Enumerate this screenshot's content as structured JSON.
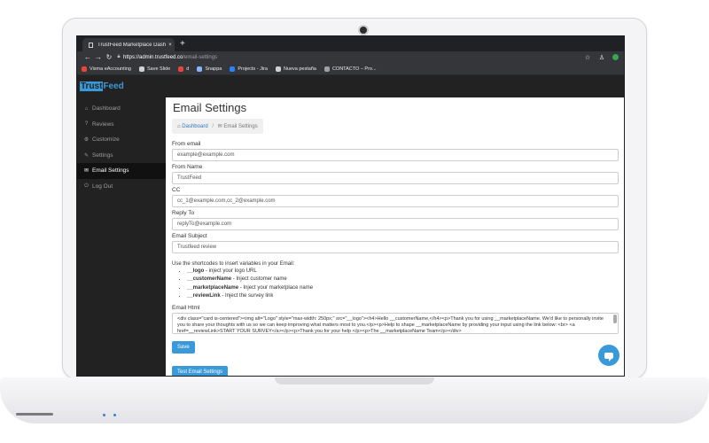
{
  "browser": {
    "tab_title": "TrustFeed Marketplace Dashbo",
    "tab_close": "×",
    "new_tab": "+",
    "url_host": "https://admin.trustfeed.co",
    "url_path": "/email-settings",
    "bookmarks": [
      {
        "label": "Visma eAccounting",
        "color": "#e8453c"
      },
      {
        "label": "Save Slide",
        "color": "#cfd1d4"
      },
      {
        "label": "d",
        "color": "#e8453c"
      },
      {
        "label": "Snappa",
        "color": "#8ab4f8"
      },
      {
        "label": "Projects - Jira",
        "color": "#2684ff"
      },
      {
        "label": "Nueva pestaña",
        "color": "#cfd1d4"
      },
      {
        "label": "CONTACTO – Pro...",
        "color": "#9aa0a6"
      }
    ]
  },
  "logo": {
    "part1": "Trust",
    "part2": "Feed"
  },
  "sidebar": {
    "items": [
      {
        "label": "Dashboard",
        "icon": "⌂"
      },
      {
        "label": "Reviews",
        "icon": "?"
      },
      {
        "label": "Customize",
        "icon": "⚙"
      },
      {
        "label": "Settings",
        "icon": "✎"
      },
      {
        "label": "Email Settings",
        "icon": "✉"
      },
      {
        "label": "Log Out",
        "icon": "⏻"
      }
    ]
  },
  "main": {
    "title": "Email Settings",
    "breadcrumb": {
      "home": "Dashboard",
      "separator": "/",
      "current": "Email Settings"
    },
    "fields": {
      "from_email": {
        "label": "From email",
        "value": "example@example.com"
      },
      "from_name": {
        "label": "From Name",
        "value": "TrustFeed"
      },
      "cc": {
        "label": "CC",
        "value": "cc_1@example.com,cc_2@example.com"
      },
      "reply_to": {
        "label": "Reply To",
        "value": "replyTo@example.com"
      },
      "subject": {
        "label": "Email Subject",
        "value": "Trustfeed review"
      }
    },
    "shortcodes": {
      "intro": "Use the shortcodes to insert variables in your Email:",
      "items": [
        {
          "code": "__logo",
          "desc": " - inject your logo URL"
        },
        {
          "code": "__customerName",
          "desc": " - Inject customer name"
        },
        {
          "code": "__marketplaceName",
          "desc": " - Inject your marketplace name"
        },
        {
          "code": "__reviewLink",
          "desc": " - Inject the survey link"
        }
      ]
    },
    "email_html": {
      "label": "Email Html",
      "value": "<div class=\"card is-centered\"><img alt=\"Logo\" style=\"max-width: 250px;\" src=\"__logo\"><h4>Hello __customerName,</h4><p>Thank you for using __marketplaceName. We'd like to personally invite you to share your thoughts with us so we can keep improving what matters most to you.</p><p>Help to shape __marketplaceName by providing your input using the link below: <br> <a href=__reviewLink>START YOUR SURVEY</a></p><p>Thank you for your help </p><p>The __marketplaceName Team</p></div>"
    },
    "save_label": "Save",
    "test_label": "Test Email Settings"
  },
  "colors": {
    "accent": "#3a9ad9",
    "sidebar_bg": "#222222",
    "active_bg": "#111111"
  }
}
